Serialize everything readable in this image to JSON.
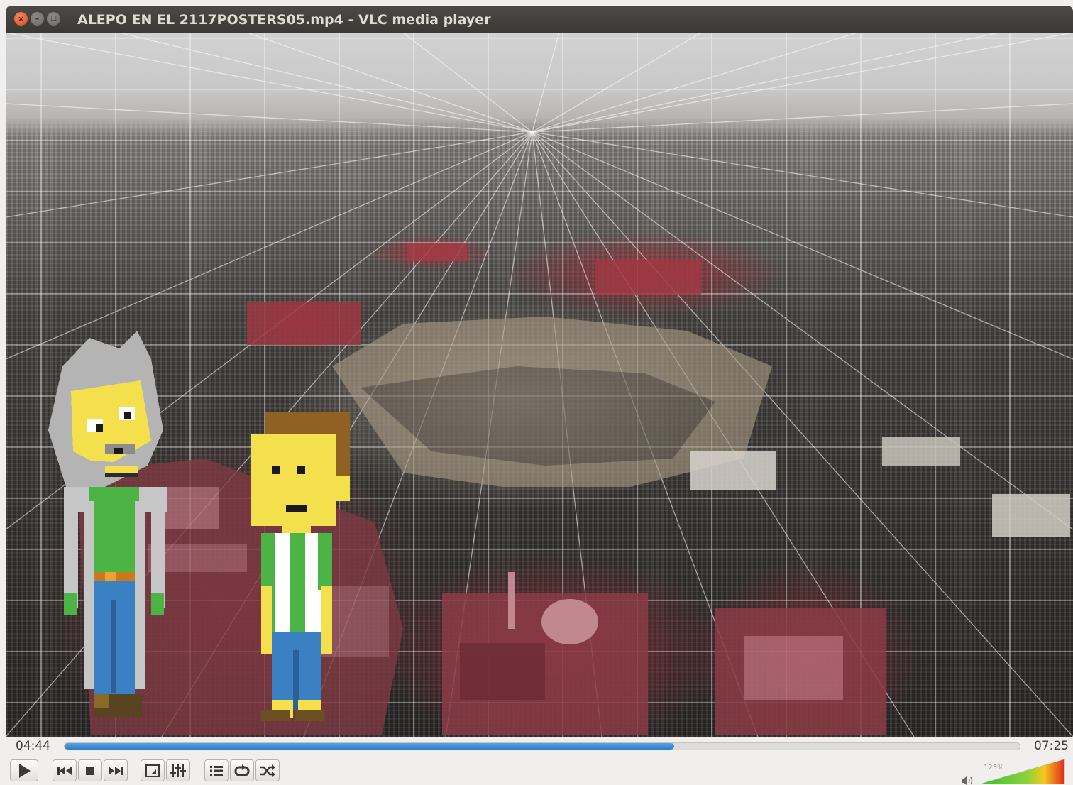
{
  "window": {
    "title": "ALEPO EN EL 2117POSTERS05.mp4 - VLC media player",
    "close_glyph": "×",
    "minimize_glyph": "–",
    "maximize_glyph": "□"
  },
  "playback": {
    "elapsed": "04:44",
    "total": "07:25",
    "progress": 0.638
  },
  "controls": {
    "buttons": [
      {
        "name": "play-button",
        "icon": "play-icon"
      },
      {
        "name": "previous-button",
        "icon": "skip-previous-icon"
      },
      {
        "name": "stop-button",
        "icon": "stop-icon"
      },
      {
        "name": "next-button",
        "icon": "skip-next-icon"
      },
      {
        "name": "fullscreen-button",
        "icon": "fullscreen-icon"
      },
      {
        "name": "extended-settings-button",
        "icon": "equalizer-sliders-icon"
      },
      {
        "name": "playlist-button",
        "icon": "playlist-icon"
      },
      {
        "name": "loop-button",
        "icon": "loop-icon"
      },
      {
        "name": "shuffle-button",
        "icon": "shuffle-icon"
      }
    ]
  },
  "volume": {
    "label": "125%",
    "level": 1.0,
    "max_percent": 125,
    "percent": 125
  },
  "colors": {
    "accent": "#2f7cc8",
    "close_button": "#df4b16",
    "titlebar": "#3c3b37"
  }
}
